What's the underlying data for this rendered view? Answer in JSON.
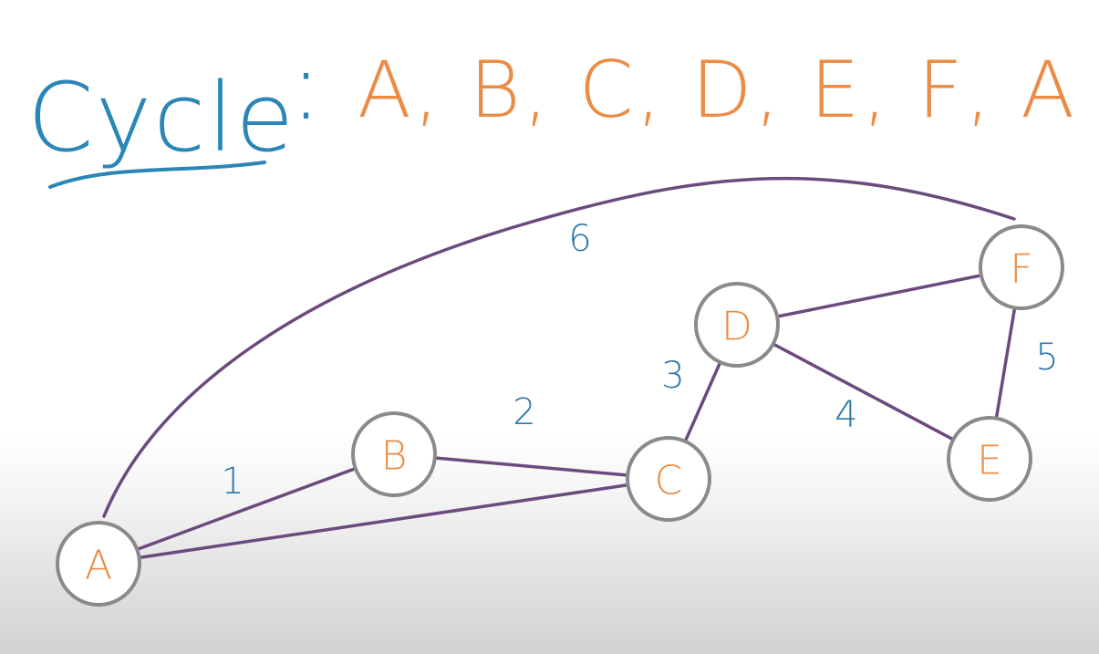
{
  "title": {
    "word": "Cycle",
    "colon": ":",
    "sequence": "A, B, C, D, E, F, A"
  },
  "graph": {
    "nodes": [
      {
        "id": "A",
        "label": "A"
      },
      {
        "id": "B",
        "label": "B"
      },
      {
        "id": "C",
        "label": "C"
      },
      {
        "id": "D",
        "label": "D"
      },
      {
        "id": "E",
        "label": "E"
      },
      {
        "id": "F",
        "label": "F"
      }
    ],
    "edges": [
      {
        "from": "A",
        "to": "B",
        "weight": "1"
      },
      {
        "from": "B",
        "to": "C",
        "weight": "2"
      },
      {
        "from": "C",
        "to": "D",
        "weight": "3"
      },
      {
        "from": "D",
        "to": "E",
        "weight": "4"
      },
      {
        "from": "E",
        "to": "F",
        "weight": "5"
      },
      {
        "from": "F",
        "to": "A",
        "weight": "6"
      },
      {
        "from": "A",
        "to": "C",
        "weight": ""
      },
      {
        "from": "D",
        "to": "F",
        "weight": ""
      }
    ]
  },
  "colors": {
    "title": "#2b86b8",
    "sequence": "#ea8c45",
    "node_label": "#ea8c45",
    "node_border": "#8a8a8a",
    "edge": "#6b4a7e",
    "weight": "#2b79a8"
  }
}
